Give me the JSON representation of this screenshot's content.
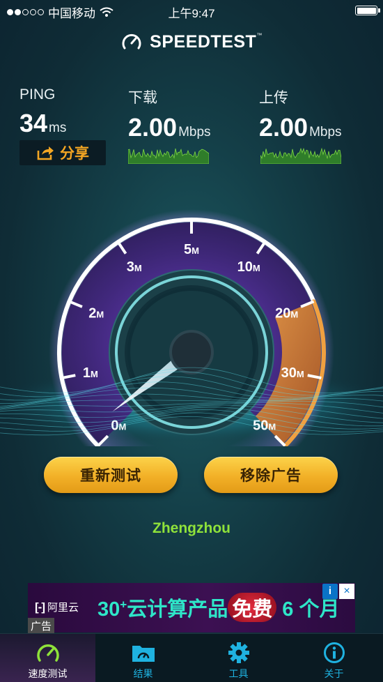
{
  "status_bar": {
    "carrier": "中国移动",
    "time": "上午9:47",
    "signal_bars": 2,
    "battery_level": 1.0
  },
  "header": {
    "logo_text": "SPEEDTEST",
    "trademark": "™"
  },
  "stats": {
    "ping": {
      "label": "PING",
      "value": "34",
      "unit": "ms"
    },
    "download": {
      "label": "下载",
      "value": "2.00",
      "unit": "Mbps"
    },
    "upload": {
      "label": "上传",
      "value": "2.00",
      "unit": "Mbps"
    }
  },
  "share_button": {
    "label": "分享"
  },
  "gauge": {
    "ticks": [
      {
        "num": "0",
        "unit": "M"
      },
      {
        "num": "1",
        "unit": "M"
      },
      {
        "num": "2",
        "unit": "M"
      },
      {
        "num": "3",
        "unit": "M"
      },
      {
        "num": "5",
        "unit": "M"
      },
      {
        "num": "10",
        "unit": "M"
      },
      {
        "num": "20",
        "unit": "M"
      },
      {
        "num": "30",
        "unit": "M"
      },
      {
        "num": "50",
        "unit": "M"
      }
    ]
  },
  "buttons": {
    "retest": "重新测试",
    "remove_ads": "移除广告"
  },
  "location": "Zhengzhou",
  "ad": {
    "brand": "阿里云",
    "brand_mark": "[-]",
    "promo_num": "30",
    "promo_plus": "+",
    "promo_text": "云计算产品",
    "promo_free": "免费",
    "promo_tail": "6 个月",
    "info_glyph": "i",
    "close_glyph": "×",
    "tag": "广告"
  },
  "tabs": [
    {
      "label": "速度测试",
      "icon": "speedometer-icon",
      "active": true
    },
    {
      "label": "结果",
      "icon": "results-folder-icon",
      "active": false
    },
    {
      "label": "工具",
      "icon": "gear-icon",
      "active": false
    },
    {
      "label": "关于",
      "icon": "info-icon",
      "active": false
    }
  ],
  "colors": {
    "accent_orange": "#f4a623",
    "location_green": "#8fe23a",
    "tab_blue": "#1fb2e0",
    "ad_teal": "#2ee6c8"
  }
}
